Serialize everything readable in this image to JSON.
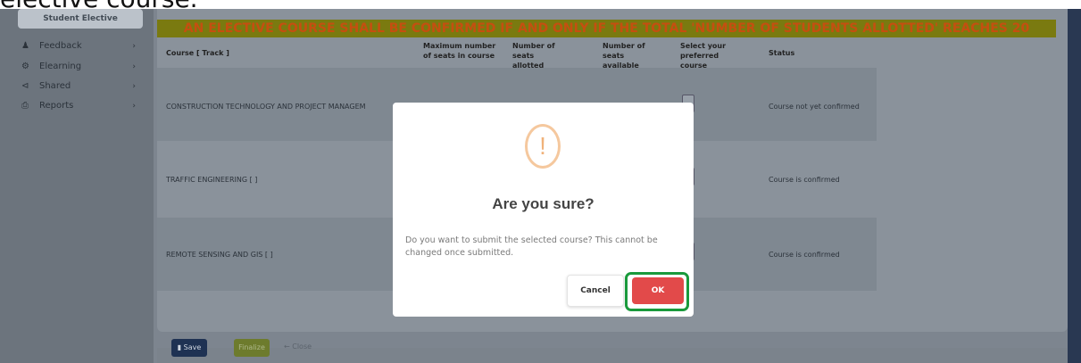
{
  "top_caption": "elective course.",
  "sidebar": {
    "active_label": "Student Elective",
    "items": [
      {
        "label": "Feedback",
        "icon": "person-icon"
      },
      {
        "label": "Elearning",
        "icon": "elearning-icon"
      },
      {
        "label": "Shared",
        "icon": "share-icon"
      },
      {
        "label": "Reports",
        "icon": "print-icon"
      }
    ]
  },
  "main": {
    "notice": "AN ELECTIVE COURSE SHALL BE CONFIRMED IF AND ONLY IF THE TOTAL 'NUMBER OF STUDENTS ALLOTTED' REACHES 20",
    "headers": {
      "course": "Course [ Track ]",
      "max": "Maximum number of seats in course",
      "allotted": "Number of seats allotted",
      "available": "Number of seats available",
      "select": "Select your preferred course",
      "status": "Status"
    },
    "rows": [
      {
        "course": "CONSTRUCTION TECHNOLOGY AND PROJECT MANAGEM",
        "status": "Course not yet confirmed"
      },
      {
        "course": "TRAFFIC ENGINEERING [ ]",
        "status": "Course is confirmed"
      },
      {
        "course": "REMOTE SENSING AND GIS [ ]",
        "status": "Course is confirmed"
      }
    ]
  },
  "footer": {
    "save_label": "Save",
    "finalize_label": "Finalize",
    "close_label": "← Close"
  },
  "modal": {
    "title": "Are you sure?",
    "text": "Do you want to submit the selected course? This cannot be changed once submitted.",
    "cancel_label": "Cancel",
    "ok_label": "OK"
  },
  "colors": {
    "notice_bg": "#7a7a10",
    "notice_text": "#c54f10",
    "ok_button": "#e24a4a",
    "highlight": "#1a9a3c",
    "warn": "#f0b27a"
  }
}
